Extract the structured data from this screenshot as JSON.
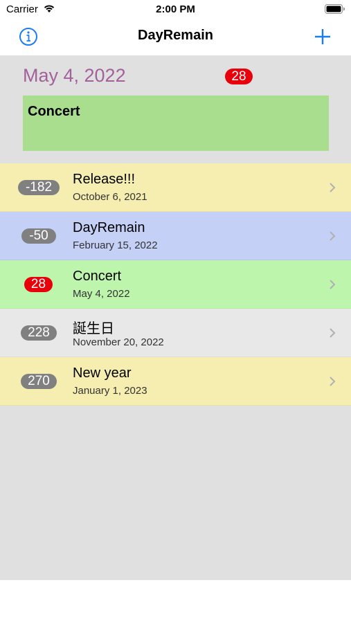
{
  "status": {
    "carrier": "Carrier",
    "time": "2:00 PM"
  },
  "nav": {
    "title": "DayRemain",
    "info_icon": "info-icon",
    "add_icon": "plus-icon"
  },
  "header": {
    "date": "May 4, 2022",
    "badge": "28",
    "card_title": "Concert",
    "date_color": "#a2619a",
    "card_color": "#a9de8e"
  },
  "events": [
    {
      "badge": "-182",
      "title": "Release!!!",
      "date": "October 6, 2021",
      "color": "#f5eeb0",
      "badge_color": "gray"
    },
    {
      "badge": "-50",
      "title": "DayRemain",
      "date": "February 15, 2022",
      "color": "#c4d0f6",
      "badge_color": "gray"
    },
    {
      "badge": "28",
      "title": "Concert",
      "date": "May 4, 2022",
      "color": "#bef5ad",
      "badge_color": "red"
    },
    {
      "badge": "228",
      "title": "誕生日",
      "date": "November 20, 2022",
      "color": "#e8e8e8",
      "badge_color": "gray"
    },
    {
      "badge": "270",
      "title": "New year",
      "date": "January 1, 2023",
      "color": "#f5eeb0",
      "badge_color": "gray"
    }
  ]
}
